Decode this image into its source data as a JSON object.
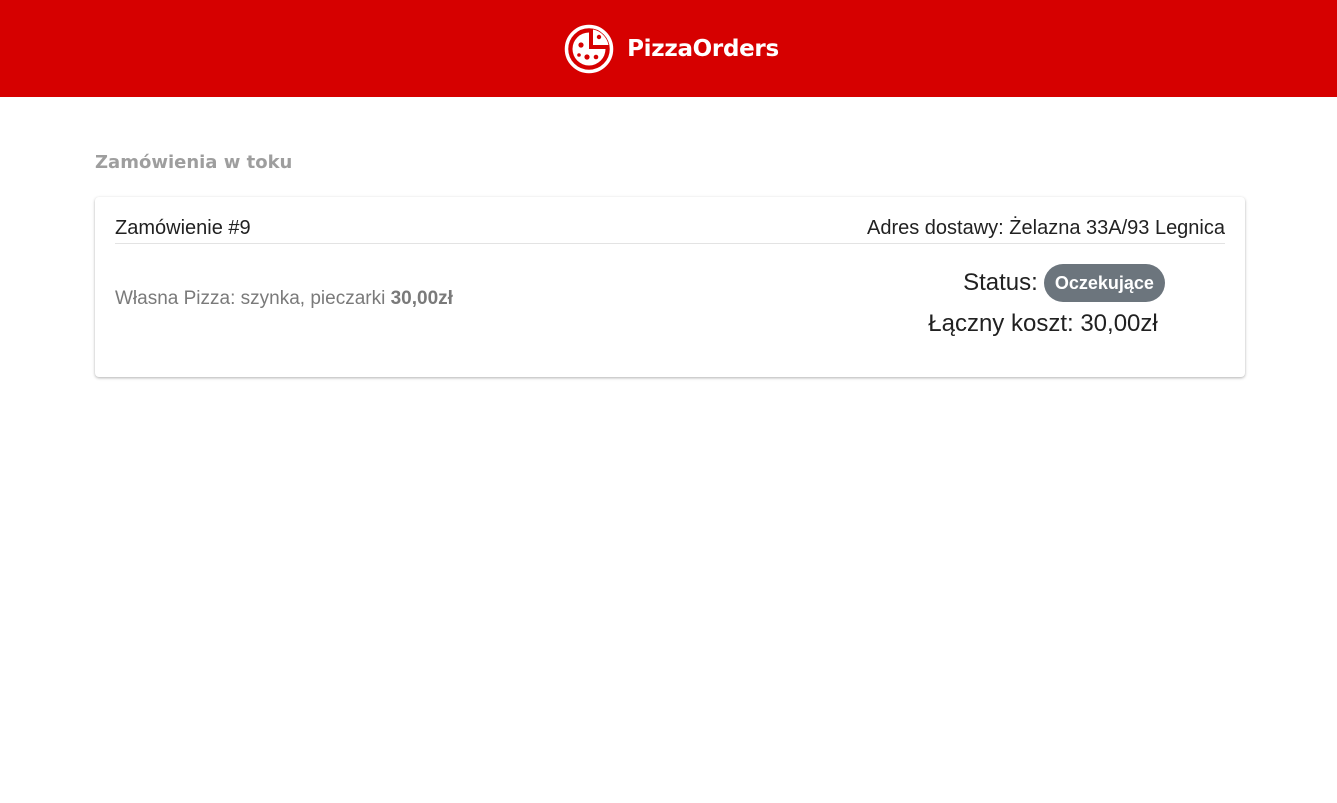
{
  "header": {
    "brand_name": "PizzaOrders",
    "logo_icon": "pizza-slice-icon",
    "background_color": "#d60000"
  },
  "section": {
    "title": "Zamówienia w toku"
  },
  "orders": [
    {
      "title": "Zamówienie #9",
      "address_label": "Adres dostawy: Żelazna 33A/93 Legnica",
      "items": [
        {
          "description": "Własna Pizza: szynka, pieczarki",
          "price": "30,00zł"
        }
      ],
      "status_label": "Status:",
      "status_value": "Oczekujące",
      "status_color": "#6c757d",
      "total_label": "Łączny koszt: 30,00zł"
    }
  ]
}
